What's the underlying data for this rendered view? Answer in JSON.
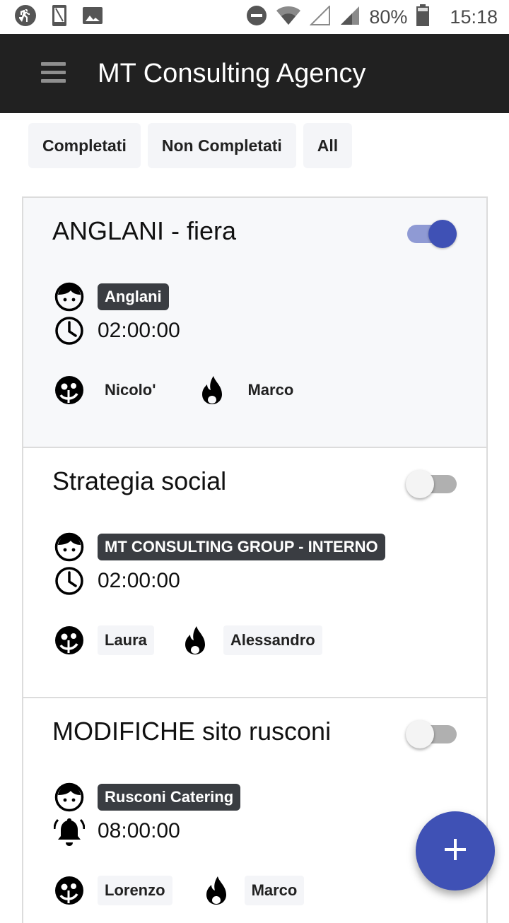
{
  "status_bar": {
    "battery": "80%",
    "time": "15:18"
  },
  "app_bar": {
    "title": "MT Consulting Agency"
  },
  "filters": [
    "Completati",
    "Non Completati",
    "All"
  ],
  "tasks": [
    {
      "title": "ANGLANI - fiera",
      "completed": true,
      "client": "Anglani",
      "time": "02:00:00",
      "time_icon": "clock-icon",
      "assignee": "Nicolo'",
      "owner": "Marco"
    },
    {
      "title": "Strategia social",
      "completed": false,
      "client": "MT CONSULTING GROUP - INTERNO",
      "time": "02:00:00",
      "time_icon": "clock-icon",
      "assignee": "Laura",
      "owner": "Alessandro"
    },
    {
      "title": "MODIFICHE sito rusconi",
      "completed": false,
      "client": "Rusconi Catering",
      "time": "08:00:00",
      "time_icon": "bell-icon",
      "assignee": "Lorenzo",
      "owner": "Marco"
    }
  ],
  "fab": {
    "icon": "plus-icon"
  },
  "colors": {
    "app_bar": "#212121",
    "accent": "#3f51b5",
    "chip_dark": "#3a3d42"
  }
}
